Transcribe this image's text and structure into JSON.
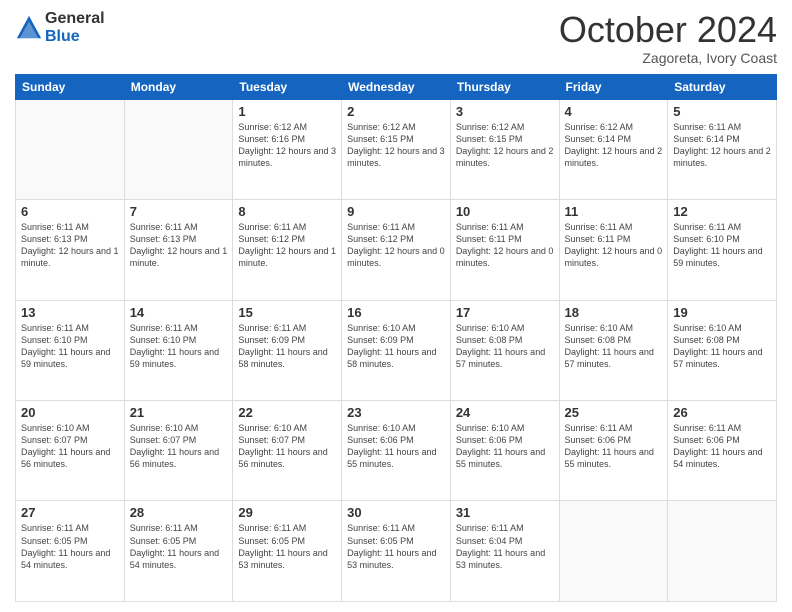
{
  "logo": {
    "general": "General",
    "blue": "Blue"
  },
  "title": "October 2024",
  "subtitle": "Zagoreta, Ivory Coast",
  "days_header": [
    "Sunday",
    "Monday",
    "Tuesday",
    "Wednesday",
    "Thursday",
    "Friday",
    "Saturday"
  ],
  "weeks": [
    [
      {
        "day": "",
        "info": ""
      },
      {
        "day": "",
        "info": ""
      },
      {
        "day": "1",
        "info": "Sunrise: 6:12 AM\nSunset: 6:16 PM\nDaylight: 12 hours and 3 minutes."
      },
      {
        "day": "2",
        "info": "Sunrise: 6:12 AM\nSunset: 6:15 PM\nDaylight: 12 hours and 3 minutes."
      },
      {
        "day": "3",
        "info": "Sunrise: 6:12 AM\nSunset: 6:15 PM\nDaylight: 12 hours and 2 minutes."
      },
      {
        "day": "4",
        "info": "Sunrise: 6:12 AM\nSunset: 6:14 PM\nDaylight: 12 hours and 2 minutes."
      },
      {
        "day": "5",
        "info": "Sunrise: 6:11 AM\nSunset: 6:14 PM\nDaylight: 12 hours and 2 minutes."
      }
    ],
    [
      {
        "day": "6",
        "info": "Sunrise: 6:11 AM\nSunset: 6:13 PM\nDaylight: 12 hours and 1 minute."
      },
      {
        "day": "7",
        "info": "Sunrise: 6:11 AM\nSunset: 6:13 PM\nDaylight: 12 hours and 1 minute."
      },
      {
        "day": "8",
        "info": "Sunrise: 6:11 AM\nSunset: 6:12 PM\nDaylight: 12 hours and 1 minute."
      },
      {
        "day": "9",
        "info": "Sunrise: 6:11 AM\nSunset: 6:12 PM\nDaylight: 12 hours and 0 minutes."
      },
      {
        "day": "10",
        "info": "Sunrise: 6:11 AM\nSunset: 6:11 PM\nDaylight: 12 hours and 0 minutes."
      },
      {
        "day": "11",
        "info": "Sunrise: 6:11 AM\nSunset: 6:11 PM\nDaylight: 12 hours and 0 minutes."
      },
      {
        "day": "12",
        "info": "Sunrise: 6:11 AM\nSunset: 6:10 PM\nDaylight: 11 hours and 59 minutes."
      }
    ],
    [
      {
        "day": "13",
        "info": "Sunrise: 6:11 AM\nSunset: 6:10 PM\nDaylight: 11 hours and 59 minutes."
      },
      {
        "day": "14",
        "info": "Sunrise: 6:11 AM\nSunset: 6:10 PM\nDaylight: 11 hours and 59 minutes."
      },
      {
        "day": "15",
        "info": "Sunrise: 6:11 AM\nSunset: 6:09 PM\nDaylight: 11 hours and 58 minutes."
      },
      {
        "day": "16",
        "info": "Sunrise: 6:10 AM\nSunset: 6:09 PM\nDaylight: 11 hours and 58 minutes."
      },
      {
        "day": "17",
        "info": "Sunrise: 6:10 AM\nSunset: 6:08 PM\nDaylight: 11 hours and 57 minutes."
      },
      {
        "day": "18",
        "info": "Sunrise: 6:10 AM\nSunset: 6:08 PM\nDaylight: 11 hours and 57 minutes."
      },
      {
        "day": "19",
        "info": "Sunrise: 6:10 AM\nSunset: 6:08 PM\nDaylight: 11 hours and 57 minutes."
      }
    ],
    [
      {
        "day": "20",
        "info": "Sunrise: 6:10 AM\nSunset: 6:07 PM\nDaylight: 11 hours and 56 minutes."
      },
      {
        "day": "21",
        "info": "Sunrise: 6:10 AM\nSunset: 6:07 PM\nDaylight: 11 hours and 56 minutes."
      },
      {
        "day": "22",
        "info": "Sunrise: 6:10 AM\nSunset: 6:07 PM\nDaylight: 11 hours and 56 minutes."
      },
      {
        "day": "23",
        "info": "Sunrise: 6:10 AM\nSunset: 6:06 PM\nDaylight: 11 hours and 55 minutes."
      },
      {
        "day": "24",
        "info": "Sunrise: 6:10 AM\nSunset: 6:06 PM\nDaylight: 11 hours and 55 minutes."
      },
      {
        "day": "25",
        "info": "Sunrise: 6:11 AM\nSunset: 6:06 PM\nDaylight: 11 hours and 55 minutes."
      },
      {
        "day": "26",
        "info": "Sunrise: 6:11 AM\nSunset: 6:06 PM\nDaylight: 11 hours and 54 minutes."
      }
    ],
    [
      {
        "day": "27",
        "info": "Sunrise: 6:11 AM\nSunset: 6:05 PM\nDaylight: 11 hours and 54 minutes."
      },
      {
        "day": "28",
        "info": "Sunrise: 6:11 AM\nSunset: 6:05 PM\nDaylight: 11 hours and 54 minutes."
      },
      {
        "day": "29",
        "info": "Sunrise: 6:11 AM\nSunset: 6:05 PM\nDaylight: 11 hours and 53 minutes."
      },
      {
        "day": "30",
        "info": "Sunrise: 6:11 AM\nSunset: 6:05 PM\nDaylight: 11 hours and 53 minutes."
      },
      {
        "day": "31",
        "info": "Sunrise: 6:11 AM\nSunset: 6:04 PM\nDaylight: 11 hours and 53 minutes."
      },
      {
        "day": "",
        "info": ""
      },
      {
        "day": "",
        "info": ""
      }
    ]
  ]
}
